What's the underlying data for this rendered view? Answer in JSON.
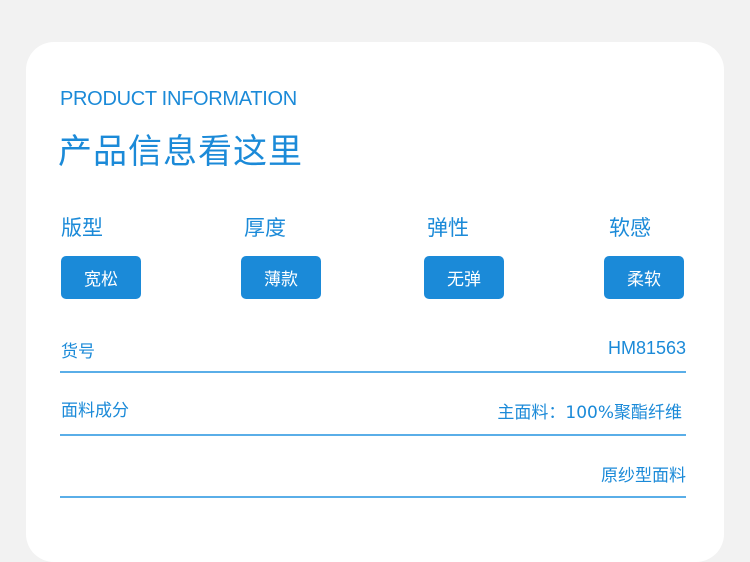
{
  "header": {
    "en_title": "PRODUCT INFORMATION",
    "cn_title": "产品信息看这里"
  },
  "attributes": [
    {
      "name": "版型",
      "tag": "宽松"
    },
    {
      "name": "厚度",
      "tag": "薄款"
    },
    {
      "name": "弹性",
      "tag": "无弹"
    },
    {
      "name": "软感",
      "tag": "柔软"
    }
  ],
  "details": {
    "item_no": {
      "label": "货号",
      "value": "HM81563"
    },
    "fabric": {
      "label": "面料成分",
      "value": "主面料：100%聚酯纤维"
    },
    "fabric_note": "原纱型面料"
  },
  "colors": {
    "accent": "#1b8ad8",
    "divider": "#5aaee8",
    "background": "#f2f2f2"
  }
}
